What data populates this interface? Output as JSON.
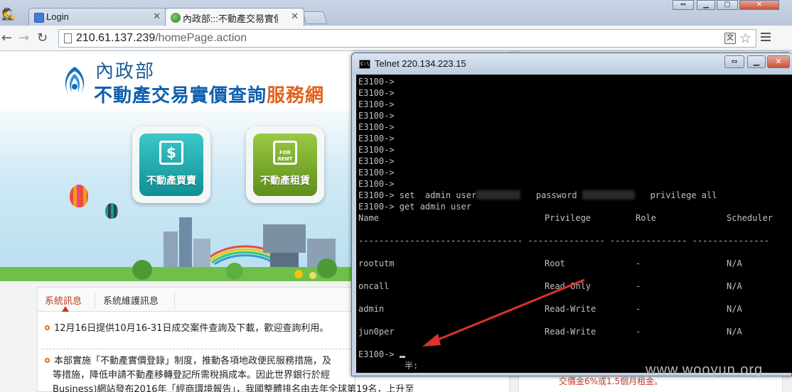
{
  "browser": {
    "tabs": [
      {
        "label": "Login"
      },
      {
        "label": "內政部:::不動產交易實價查"
      }
    ],
    "url": {
      "host": "210.61.137.239",
      "path": "/homePage.action"
    }
  },
  "site": {
    "title_line1": "內政部",
    "title_line2_main": "不動產交易實價查詢",
    "title_line2_accent": "服務網",
    "buttons": {
      "buy": "不動產買賣",
      "rent": "不動產租賃"
    },
    "rent_icon_text": "FOR RENT",
    "news_tabs": [
      "系統訊息",
      "系統維護訊息"
    ],
    "news_items": [
      "12月16日提供10月16-31日成交案件查詢及下載，歡迎查詢利用。",
      "本部實施「不動產實價登錄」制度，推動各項地政便民服務措施，及",
      "等措施，降低申請不動產移轉登記所需稅捐成本。因此世界銀行於經",
      "Business)網站發布2016年「經商環境報告」，我國整體排名由去年全球第19名，上升至"
    ],
    "right_bottom_text": "交價金6%或1.5個月租金。"
  },
  "telnet": {
    "title": "Telnet 220.134.223.15",
    "prompt": "E3100->",
    "empty_prompts": 10,
    "set_command": {
      "prefix": "set  admin user",
      "password_label": "password",
      "privilege": "privilege all"
    },
    "get_command": "get admin user",
    "columns": [
      "Name",
      "Privilege",
      "Role",
      "Scheduler"
    ],
    "rows": [
      {
        "name": "rootutm",
        "privilege": "Root",
        "role": "-",
        "scheduler": "N/A"
      },
      {
        "name": "oncall",
        "privilege": "Read-Only",
        "role": "-",
        "scheduler": "N/A"
      },
      {
        "name": "admin",
        "privilege": "Read-Write",
        "role": "-",
        "scheduler": "N/A"
      },
      {
        "name": "jun0per",
        "privilege": "Read-Write",
        "role": "-",
        "scheduler": "N/A"
      }
    ],
    "ime_text": "半:"
  },
  "watermark": "www.wooyun.org",
  "colors": {
    "console_bg": "#000000",
    "console_fg": "#c0c0c0",
    "arrow": "#e0312c",
    "brand_blue": "#0f5fae",
    "brand_orange": "#e1621d"
  }
}
